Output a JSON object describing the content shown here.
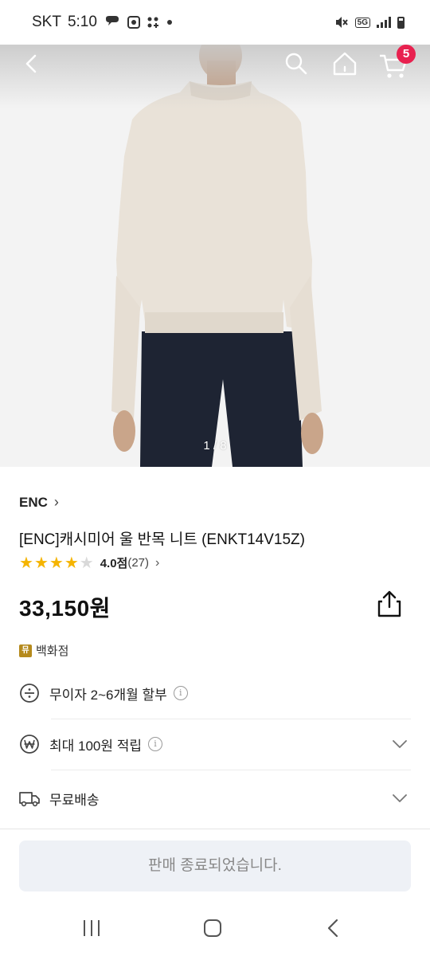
{
  "status_bar": {
    "carrier": "SKT",
    "time": "5:10",
    "network": "5G"
  },
  "header": {
    "cart_count": "5"
  },
  "gallery": {
    "counter": "1 / 8"
  },
  "product": {
    "brand": "ENC",
    "brand_chevron": "›",
    "title": "[ENC]캐시미어 울 반목 니트 (ENKT14V15Z)",
    "rating_value": 4,
    "rating_max": 5,
    "rating_text": "4.0점",
    "review_count": "(27)",
    "rating_chevron": "›",
    "price": "33,150원",
    "store_badge_icon": "뮤",
    "store_label": "백화점"
  },
  "benefits": [
    {
      "icon": "divide-icon",
      "label": "무이자 2~6개월 할부",
      "has_info": true,
      "has_chevron": false
    },
    {
      "icon": "won-icon",
      "label": "최대 100원 적립",
      "has_info": true,
      "has_chevron": true
    },
    {
      "icon": "truck-icon",
      "label": "무료배송",
      "has_info": false,
      "has_chevron": true
    }
  ],
  "info_glyph": "i",
  "cta": {
    "label": "판매 종료되었습니다."
  },
  "colors": {
    "accent_badge": "#e8214f",
    "star": "#f5b400",
    "sweater": "#e9e2d8",
    "pants": "#1e2433",
    "cta_bg": "#eef1f6"
  }
}
